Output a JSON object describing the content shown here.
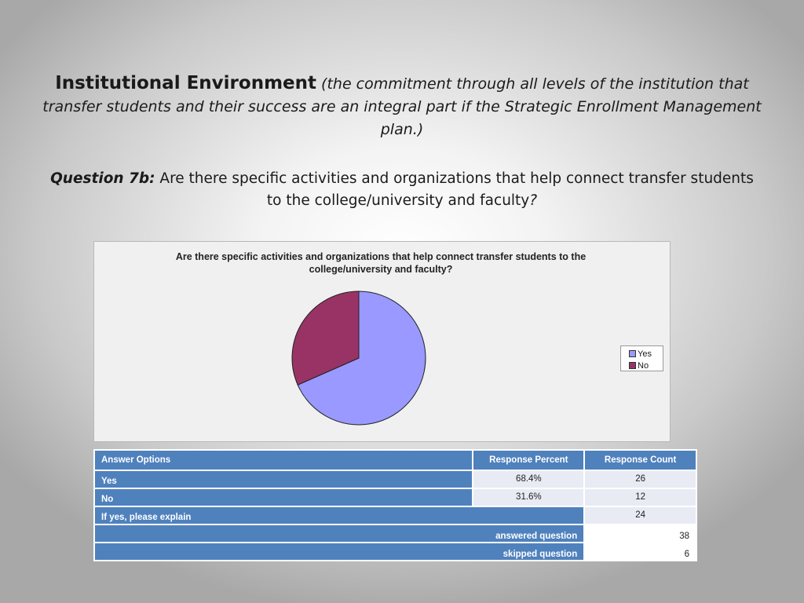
{
  "slide": {
    "title_main": "Institutional Environment",
    "title_open_paren": " (",
    "title_desc": "the commitment through all levels of the institution that transfer students and their success are an integral part if the Strategic Enrollment Management plan.)",
    "question_label": "Question 7b:",
    "question_text": " Are there specific activities and organizations that help connect transfer students to the college/university and faculty",
    "question_mark": "?"
  },
  "chart_data": {
    "type": "pie",
    "title": "Are there specific activities and organizations that help connect transfer students to the college/university and faculty?",
    "categories": [
      "Yes",
      "No"
    ],
    "values": [
      68.4,
      31.6
    ],
    "colors": [
      "#9999ff",
      "#993366"
    ],
    "legend_position": "right"
  },
  "table": {
    "headers": [
      "Answer Options",
      "Response Percent",
      "Response Count"
    ],
    "rows": [
      {
        "label": "Yes",
        "percent": "68.4%",
        "count": "26"
      },
      {
        "label": "No",
        "percent": "31.6%",
        "count": "12"
      },
      {
        "label": "If yes, please explain",
        "count": "24"
      }
    ],
    "summary": [
      {
        "label": "answered question",
        "value": "38"
      },
      {
        "label": "skipped question",
        "value": "6"
      }
    ]
  }
}
